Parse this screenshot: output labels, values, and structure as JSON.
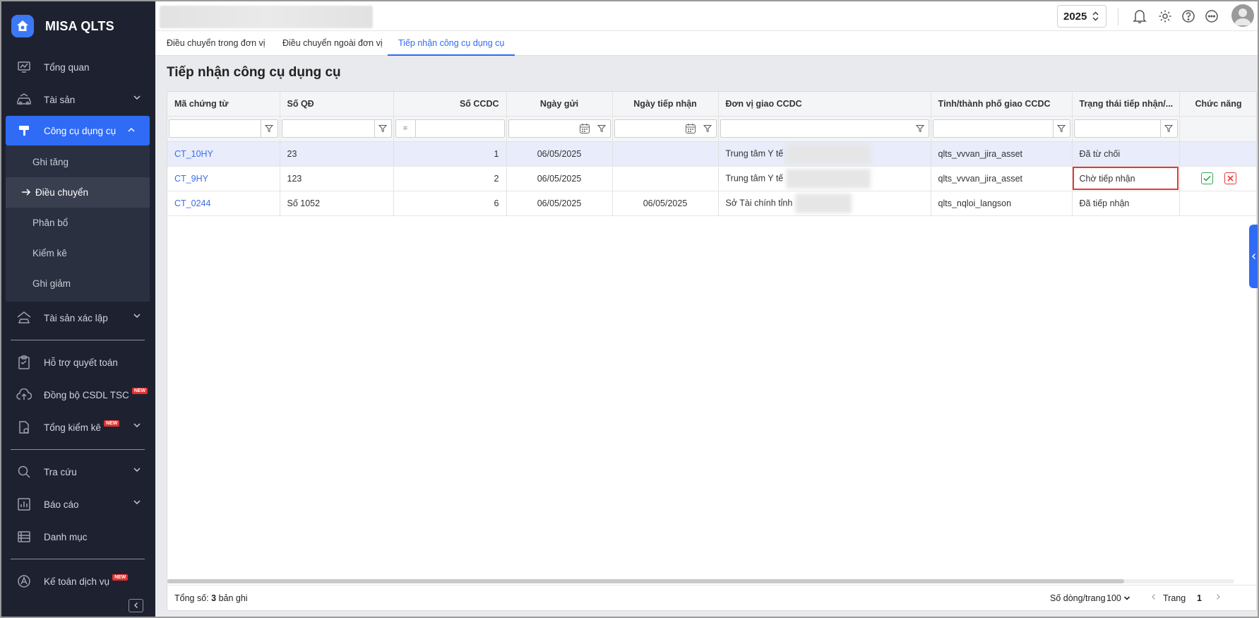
{
  "app": {
    "name": "MISA QLTS"
  },
  "sidebar": {
    "items": [
      {
        "label": "Tổng quan"
      },
      {
        "label": "Tài sản"
      },
      {
        "label": "Công cụ dụng cụ"
      },
      {
        "label": "Tài sản xác lập"
      },
      {
        "label": "Hỗ trợ quyết toán"
      },
      {
        "label": "Đồng bộ CSDL TSC",
        "badge": "NEW"
      },
      {
        "label": "Tổng kiểm kê",
        "badge": "NEW"
      },
      {
        "label": "Tra cứu"
      },
      {
        "label": "Báo cáo"
      },
      {
        "label": "Danh mục"
      },
      {
        "label": "Kế toán dịch vụ",
        "badge": "NEW"
      }
    ],
    "submenu": [
      {
        "label": "Ghi tăng"
      },
      {
        "label": "Điều chuyển"
      },
      {
        "label": "Phân bổ"
      },
      {
        "label": "Kiểm kê"
      },
      {
        "label": "Ghi giảm"
      }
    ]
  },
  "topbar": {
    "year": "2025"
  },
  "tabs": [
    {
      "label": "Điều chuyển trong đơn vị"
    },
    {
      "label": "Điều chuyển ngoài đơn vị"
    },
    {
      "label": "Tiếp nhận công cụ dụng cụ"
    }
  ],
  "page": {
    "title": "Tiếp nhận công cụ dụng cụ"
  },
  "grid": {
    "columns": [
      "Mã chứng từ",
      "Số QĐ",
      "Số CCDC",
      "Ngày gửi",
      "Ngày tiếp nhận",
      "Đơn vị giao CCDC",
      "Tỉnh/thành phố giao CCDC",
      "Trạng thái tiếp nhận/...",
      "Chức năng"
    ],
    "filter_eq": "=",
    "rows": [
      {
        "code": "CT_10HY",
        "decision": "23",
        "qty": "1",
        "sent": "06/05/2025",
        "received": "",
        "unit": "Trung tâm Y tế",
        "province": "qlts_vvvan_jira_asset",
        "status": "Đã từ chối"
      },
      {
        "code": "CT_9HY",
        "decision": "123",
        "qty": "2",
        "sent": "06/05/2025",
        "received": "",
        "unit": "Trung tâm Y tế",
        "province": "qlts_vvvan_jira_asset",
        "status": "Chờ tiếp nhận"
      },
      {
        "code": "CT_0244",
        "decision": "Số 1052",
        "qty": "6",
        "sent": "06/05/2025",
        "received": "06/05/2025",
        "unit": "Sở Tài chính tỉnh",
        "province": "qlts_nqloi_langson",
        "status": "Đã tiếp nhận"
      }
    ]
  },
  "footer": {
    "total_label": "Tổng số:",
    "total_count": "3",
    "total_suffix": "bản ghi",
    "rows_per_page_label": "Số dòng/trang",
    "rows_per_page": "100",
    "page_label": "Trang",
    "page": "1"
  },
  "colors": {
    "accent": "#2f6bf5",
    "sidebar_bg": "#1e2230",
    "rejected": "#e5484d",
    "pending": "#f0743f",
    "accepted": "#2fa84f"
  }
}
